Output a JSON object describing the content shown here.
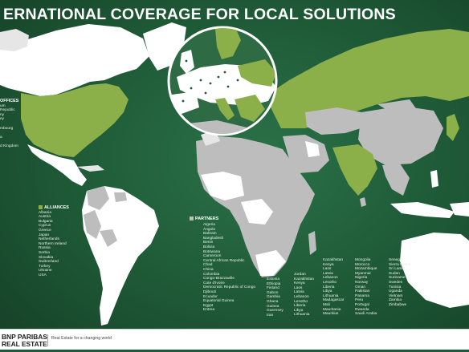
{
  "title": "ERNATIONAL COVERAGE FOR LOCAL SOLUTIONS",
  "offices": {
    "heading": "OFFICES",
    "items": [
      "um",
      "Republic",
      "ny",
      "ey",
      "",
      "mbourg",
      "",
      "a",
      "",
      "d Kingdom"
    ]
  },
  "alliances": {
    "heading": "ALLIANCES",
    "items": [
      "Albania",
      "Austria",
      "Bulgaria",
      "Cyprus",
      "Greece",
      "Japan",
      "Netherlands",
      "Northern Ireland",
      "Russia",
      "Serbia",
      "Slovakia",
      "Switzerland",
      "Turkey",
      "Ukraine",
      "USA"
    ]
  },
  "partners": {
    "heading": "PARTNERS",
    "col1": [
      "Algeria",
      "Angola",
      "Bahrain",
      "Bangladesh",
      "Benin",
      "Bolivia",
      "Botswana",
      "Cameroon",
      "Central African Republic",
      "Chad",
      "China",
      "Colombia",
      "Congo-Brazzaville",
      "Cote d'Ivoire",
      "Democratic Republic of Congo",
      "Djibouti",
      "Ecuador",
      "Equatorial Guinea",
      "Egypt",
      "Eritrea"
    ],
    "col2": [
      "Estonia",
      "Ethiopia",
      "Finland",
      "Gabon",
      "Gambia",
      "Ghana",
      "Guinea",
      "Guernsey",
      "Iran"
    ],
    "col3": [
      "Jordan",
      "Kazakhstan",
      "Kenya",
      "Laos",
      "Latvia",
      "Lebanon",
      "Lesotho",
      "Liberia",
      "Libya",
      "Lithuania"
    ],
    "col4": [
      "Kazakhstan",
      "Kenya",
      "Laos",
      "Latvia",
      "Lebanon",
      "Lesotho",
      "Liberia",
      "Libya",
      "Lithuania",
      "Madagascar",
      "Mali",
      "Mauritania",
      "Mauritius"
    ],
    "col5": [
      "Mongolia",
      "Morocco",
      "Mozambique",
      "Myanmar",
      "Nigeria",
      "Norway",
      "Oman",
      "Pakistan",
      "Panama",
      "Peru",
      "Portugal",
      "Rwanda",
      "Saudi Arabia"
    ],
    "col6": [
      "Senegal",
      "Sierra Leone",
      "Sri Lanka",
      "Sudan",
      "Suriname",
      "Sweden",
      "Tunisia",
      "Uganda",
      "Vietnam",
      "Zambia",
      "Zimbabwe"
    ]
  },
  "footer": {
    "brand_line1": "BNP PARIBAS",
    "brand_line2": "REAL ESTATE",
    "tagline": "Real Estate for a changing world"
  },
  "colors": {
    "background": "#1f5a38",
    "office": "#ffffff",
    "alliance": "#8bb04a",
    "partner": "#bdbdbd"
  }
}
